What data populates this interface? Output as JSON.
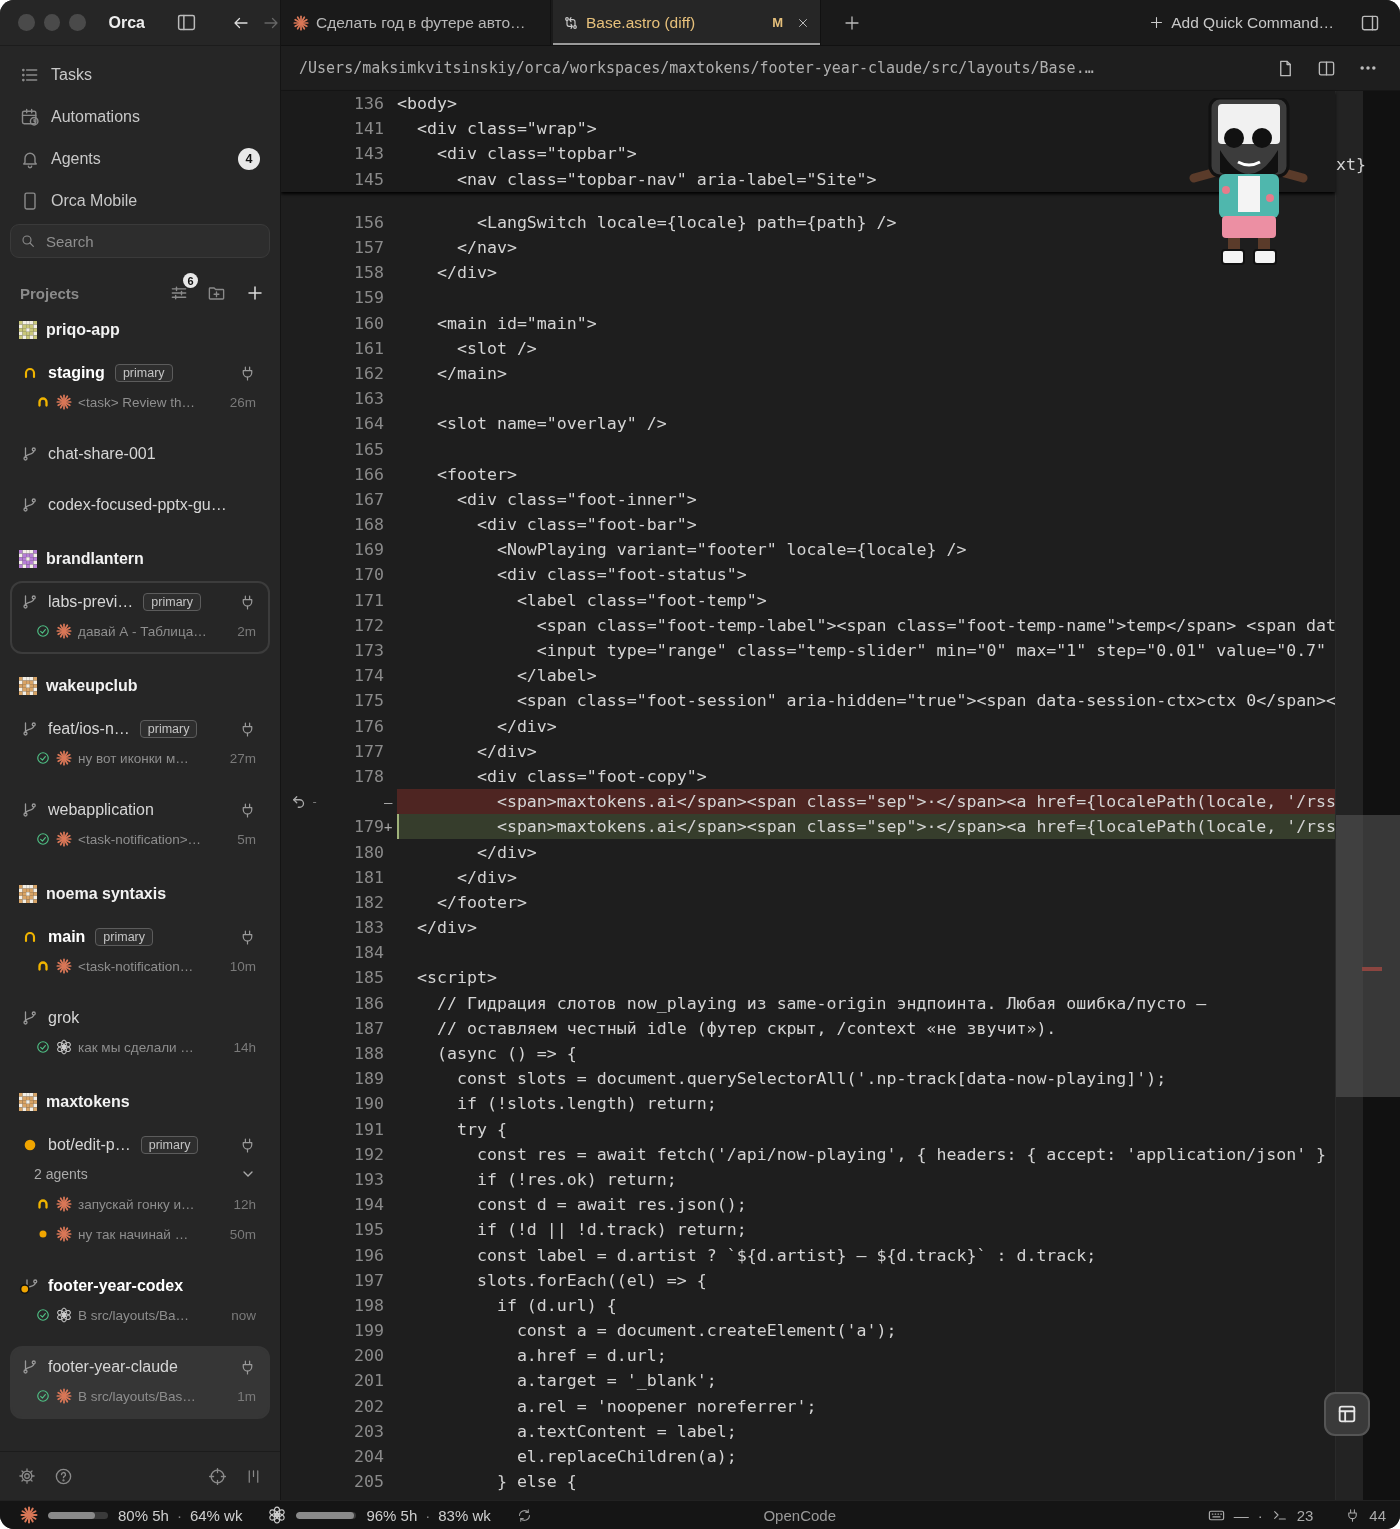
{
  "titlebar": {
    "title": "Orca",
    "back_enabled": true,
    "forward_enabled": false
  },
  "nav": [
    {
      "label": "Tasks"
    },
    {
      "label": "Automations"
    },
    {
      "label": "Agents",
      "count": "4"
    },
    {
      "label": "Orca Mobile"
    }
  ],
  "search": {
    "placeholder": "Search"
  },
  "projects_header": {
    "title": "Projects",
    "filter_count": "6"
  },
  "projects": [
    {
      "name": "priqo-app",
      "color": "#c9c77a",
      "worktrees": [
        {
          "name": "staging",
          "kind": "spinner",
          "unread": true,
          "badge": "primary",
          "plug": true,
          "selected": false,
          "focused": false,
          "agents": [
            {
              "kind": "claude",
              "working": true,
              "done": false,
              "text": "<task> Review th…",
              "time": "26m"
            }
          ]
        },
        {
          "name": "chat-share-001",
          "kind": "branch",
          "unread": false,
          "plug": false,
          "selected": false,
          "focused": false
        },
        {
          "name": "codex-focused-pptx-gu…",
          "kind": "branch",
          "unread": false,
          "plug": false,
          "selected": false,
          "focused": false
        }
      ]
    },
    {
      "name": "brandlantern",
      "color": "#b77fd6",
      "worktrees": [
        {
          "name": "labs-previ…",
          "kind": "branch",
          "unread": false,
          "badge": "primary",
          "plug": true,
          "selected": false,
          "focused": true,
          "agents": [
            {
              "kind": "claude",
              "working": false,
              "done": true,
              "text": "давай А - Таблица…",
              "time": "2m"
            }
          ]
        }
      ]
    },
    {
      "name": "wakeupclub",
      "color": "#d8a466",
      "worktrees": [
        {
          "name": "feat/ios-n…",
          "kind": "branch",
          "unread": false,
          "badge": "primary",
          "plug": true,
          "selected": false,
          "focused": false,
          "agents": [
            {
              "kind": "claude",
              "working": false,
              "done": true,
              "text": "ну вот иконки м…",
              "time": "27m"
            }
          ]
        },
        {
          "name": "webapplication",
          "kind": "branch",
          "unread": false,
          "plug": true,
          "selected": false,
          "focused": false,
          "agents": [
            {
              "kind": "claude",
              "working": false,
              "done": true,
              "text": "<task-notification>…",
              "time": "5m"
            }
          ]
        }
      ]
    },
    {
      "name": "noema syntaxis",
      "color": "#d8a466",
      "worktrees": [
        {
          "name": "main",
          "kind": "spinner",
          "unread": true,
          "badge": "primary",
          "plug": true,
          "selected": false,
          "focused": false,
          "agents": [
            {
              "kind": "claude",
              "working": true,
              "done": false,
              "text": "<task-notification…",
              "time": "10m"
            }
          ]
        },
        {
          "name": "grok",
          "kind": "branch",
          "unread": false,
          "plug": false,
          "selected": false,
          "focused": false,
          "agents": [
            {
              "kind": "openai",
              "working": false,
              "done": true,
              "text": "как мы сделали …",
              "time": "14h"
            }
          ]
        }
      ]
    },
    {
      "name": "maxtokens",
      "color": "#d8a466",
      "worktrees": [
        {
          "name": "bot/edit-p…",
          "kind": "dot",
          "unread": false,
          "badge": "primary",
          "plug": true,
          "selected": false,
          "focused": false,
          "agents_summary": "2 agents",
          "expanded": true,
          "agents": [
            {
              "kind": "claude",
              "working": true,
              "done": false,
              "text": "запускай гонку и…",
              "time": "12h"
            },
            {
              "kind": "claude",
              "working": false,
              "done": false,
              "text": "ну так начинай …",
              "time": "50m"
            }
          ]
        },
        {
          "name": "footer-year-codex",
          "kind": "branch-dot",
          "unread": true,
          "plug": false,
          "selected": false,
          "focused": false,
          "agents": [
            {
              "kind": "openai",
              "working": false,
              "done": true,
              "text": "В src/layouts/Ba…",
              "time": "now"
            }
          ]
        },
        {
          "name": "footer-year-claude",
          "kind": "branch",
          "unread": false,
          "plug": true,
          "selected": true,
          "focused": false,
          "agents": [
            {
              "kind": "claude",
              "working": false,
              "done": true,
              "text": "В src/layouts/Bas…",
              "time": "1m"
            }
          ]
        }
      ]
    }
  ],
  "tabs": [
    {
      "label": "Сделать год в футере авто…",
      "kind": "task",
      "selected": false
    },
    {
      "label": "Base.astro (diff)",
      "kind": "diff",
      "selected": true,
      "badge": "M",
      "closable": true
    }
  ],
  "quick_command": "Add Quick Command…",
  "path": "/Users/maksimkvitsinskiy/orca/workspaces/maxtokens/footer-year-claude/src/layouts/Base.…",
  "sticky_lines": [
    {
      "number": "136",
      "text": "<body>"
    },
    {
      "number": "141",
      "text": "  <div class=\"wrap\">"
    },
    {
      "number": "143",
      "text": "    <div class=\"topbar\">"
    },
    {
      "number": "145",
      "text": "      <nav class=\"topbar-nav\" aria-label=\"Site\">"
    }
  ],
  "obscured_fragment": "xt}",
  "lines": [
    {
      "number": "156",
      "kind": "context",
      "text": "        <LangSwitch locale={locale} path={path} />"
    },
    {
      "number": "157",
      "kind": "context",
      "text": "      </nav>"
    },
    {
      "number": "158",
      "kind": "context",
      "text": "    </div>"
    },
    {
      "number": "159",
      "kind": "context"
    },
    {
      "number": "160",
      "kind": "context",
      "text": "    <main id=\"main\">"
    },
    {
      "number": "161",
      "kind": "context",
      "text": "      <slot />"
    },
    {
      "number": "162",
      "kind": "context",
      "text": "    </main>"
    },
    {
      "number": "163",
      "kind": "context"
    },
    {
      "number": "164",
      "kind": "context",
      "text": "    <slot name=\"overlay\" />"
    },
    {
      "number": "165",
      "kind": "context"
    },
    {
      "number": "166",
      "kind": "context",
      "text": "    <footer>"
    },
    {
      "number": "167",
      "kind": "context",
      "text": "      <div class=\"foot-inner\">"
    },
    {
      "number": "168",
      "kind": "context",
      "text": "        <div class=\"foot-bar\">"
    },
    {
      "number": "169",
      "kind": "context",
      "text": "          <NowPlaying variant=\"footer\" locale={locale} />"
    },
    {
      "number": "170",
      "kind": "context",
      "text": "          <div class=\"foot-status\">"
    },
    {
      "number": "171",
      "kind": "context",
      "text": "            <label class=\"foot-temp\">"
    },
    {
      "number": "172",
      "kind": "context",
      "text": "              <span class=\"foot-temp-label\"><span class=\"foot-temp-name\">temp</span> <span dat"
    },
    {
      "number": "173",
      "kind": "context",
      "text": "              <input type=\"range\" class=\"temp-slider\" min=\"0\" max=\"1\" step=\"0.01\" value=\"0.7\""
    },
    {
      "number": "174",
      "kind": "context",
      "text": "            </label>"
    },
    {
      "number": "175",
      "kind": "context",
      "text": "            <span class=\"foot-session\" aria-hidden=\"true\"><span data-session-ctx>ctx 0</span><"
    },
    {
      "number": "176",
      "kind": "context",
      "text": "          </div>"
    },
    {
      "number": "177",
      "kind": "context",
      "text": "        </div>"
    },
    {
      "number": "178",
      "kind": "context",
      "text": "        <div class=\"foot-copy\">"
    },
    {
      "kind": "removed",
      "fold": "-",
      "sign": "—",
      "text": "          <span>maxtokens.ai</span><span class=\"sep\">·</span><a href={localePath(locale, '/rss"
    },
    {
      "number": "179",
      "kind": "added",
      "sign": "+",
      "text": "          <span>maxtokens.ai</span><span class=\"sep\">·</span><a href={localePath(locale, '/rss"
    },
    {
      "number": "180",
      "kind": "context",
      "text": "        </div>"
    },
    {
      "number": "181",
      "kind": "context",
      "text": "      </div>"
    },
    {
      "number": "182",
      "kind": "context",
      "text": "    </footer>"
    },
    {
      "number": "183",
      "kind": "context",
      "text": "  </div>"
    },
    {
      "number": "184",
      "kind": "context"
    },
    {
      "number": "185",
      "kind": "context",
      "text": "  <script>"
    },
    {
      "number": "186",
      "kind": "context",
      "text": "    // Гидрация слотов now_playing из same-origin эндпоинта. Любая ошибка/пусто —"
    },
    {
      "number": "187",
      "kind": "context",
      "text": "    // оставляем честный idle (футер скрыт, /context «не звучит»)."
    },
    {
      "number": "188",
      "kind": "context",
      "text": "    (async () => {"
    },
    {
      "number": "189",
      "kind": "context",
      "text": "      const slots = document.querySelectorAll('.np-track[data-now-playing]');"
    },
    {
      "number": "190",
      "kind": "context",
      "text": "      if (!slots.length) return;"
    },
    {
      "number": "191",
      "kind": "context",
      "text": "      try {"
    },
    {
      "number": "192",
      "kind": "context",
      "text": "        const res = await fetch('/api/now-playing', { headers: { accept: 'application/json' }"
    },
    {
      "number": "193",
      "kind": "context",
      "text": "        if (!res.ok) return;"
    },
    {
      "number": "194",
      "kind": "context",
      "text": "        const d = await res.json();"
    },
    {
      "number": "195",
      "kind": "context",
      "text": "        if (!d || !d.track) return;"
    },
    {
      "number": "196",
      "kind": "context",
      "text": "        const label = d.artist ? `${d.artist} — ${d.track}` : d.track;"
    },
    {
      "number": "197",
      "kind": "context",
      "text": "        slots.forEach((el) => {"
    },
    {
      "number": "198",
      "kind": "context",
      "text": "          if (d.url) {"
    },
    {
      "number": "199",
      "kind": "context",
      "text": "            const a = document.createElement('a');"
    },
    {
      "number": "200",
      "kind": "context",
      "text": "            a.href = d.url;"
    },
    {
      "number": "201",
      "kind": "context",
      "text": "            a.target = '_blank';"
    },
    {
      "number": "202",
      "kind": "context",
      "text": "            a.rel = 'noopener noreferrer';"
    },
    {
      "number": "203",
      "kind": "context",
      "text": "            a.textContent = label;"
    },
    {
      "number": "204",
      "kind": "context",
      "text": "            el.replaceChildren(a);"
    },
    {
      "number": "205",
      "kind": "context",
      "text": "          } else {"
    }
  ],
  "status_bar": {
    "usage": [
      {
        "kind": "claude",
        "level": 0.78,
        "session": "80% 5h",
        "sep": "·",
        "week": "64% wk"
      },
      {
        "kind": "openai",
        "level": 0.96,
        "session": "96% 5h",
        "sep": "·",
        "week": "83% wk"
      }
    ],
    "center": "OpenCode",
    "dash": "—",
    "dot": "·",
    "terminals": "23",
    "ports": "44"
  }
}
